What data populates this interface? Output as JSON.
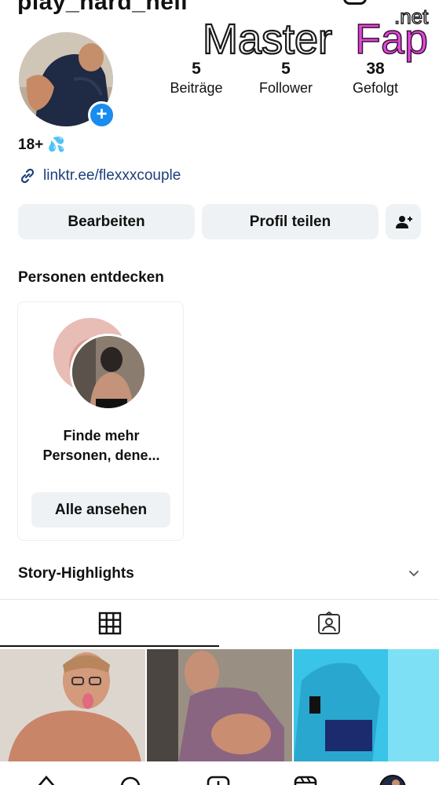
{
  "profile": {
    "username": "play_hard_hell",
    "stats": [
      {
        "value": "5",
        "label": "Beiträge"
      },
      {
        "value": "5",
        "label": "Follower"
      },
      {
        "value": "38",
        "label": "Gefolgt"
      }
    ],
    "bio_text": "18+",
    "bio_emoji": "💦",
    "link": "linktr.ee/flexxxcouple"
  },
  "watermark": {
    "brand_a": "Master",
    "brand_b": "Fap",
    "suffix": ".net"
  },
  "actions": {
    "edit": "Bearbeiten",
    "share": "Profil teilen"
  },
  "discover": {
    "title": "Personen entdecken",
    "card_line1": "Finde mehr",
    "card_line2": "Personen, dene...",
    "card_button": "Alle ansehen"
  },
  "highlights": {
    "title": "Story-Highlights"
  },
  "colors": {
    "accent_blue": "#1a8cf0",
    "link_blue": "#1d3f7a",
    "button_bg": "#eff2f4"
  },
  "icons": {
    "add_friend": "person-plus-icon",
    "link": "link-icon",
    "grid_tab": "grid-icon",
    "tagged_tab": "tagged-person-icon",
    "chevron": "chevron-down-icon"
  }
}
